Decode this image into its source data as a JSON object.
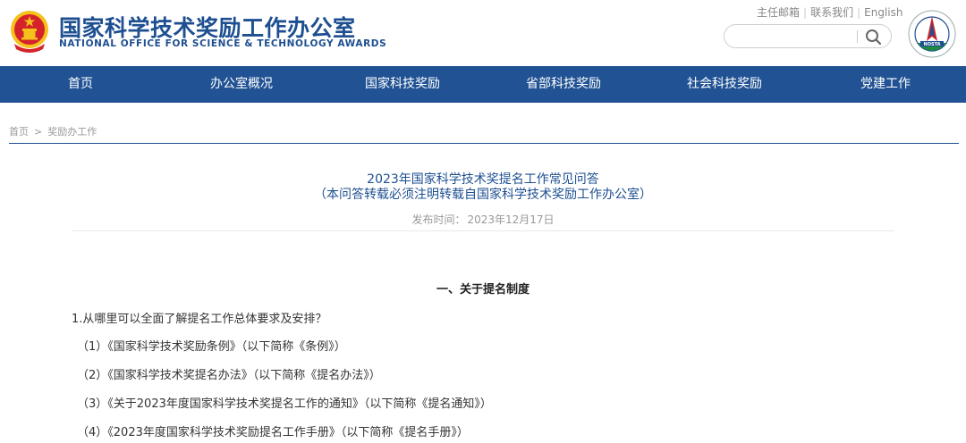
{
  "site": {
    "title_cn": "国家科学技术奖励工作办公室",
    "title_en": "NATIONAL OFFICE FOR SCIENCE & TECHNOLOGY AWARDS",
    "logo_text": "NOSTA"
  },
  "top_links": [
    "主任邮箱",
    "联系我们",
    "English"
  ],
  "search": {
    "placeholder": ""
  },
  "nav": [
    "首页",
    "办公室概况",
    "国家科技奖励",
    "省部科技奖励",
    "社会科技奖励",
    "党建工作"
  ],
  "breadcrumb": [
    "首页",
    ">",
    "奖励办工作"
  ],
  "article": {
    "title": "2023年国家科学技术奖提名工作常见问答",
    "subtitle": "（本问答转载必须注明转载自国家科学技术奖励工作办公室）",
    "date_label": "发布时间：",
    "date": "2023年12月17日"
  },
  "content": {
    "section_heading": "一、关于提名制度",
    "question": "1.从哪里可以全面了解提名工作总体要求及安排？",
    "answers": [
      "（1）《国家科学技术奖励条例》（以下简称《条例》）",
      "（2）《国家科学技术奖提名办法》（以下简称《提名办法》）",
      "（3）《关于2023年度国家科学技术奖提名工作的通知》（以下简称《提名通知》）",
      "（4）《2023年度国家科学技术奖励提名工作手册》（以下简称《提名手册》）"
    ]
  },
  "colors": {
    "brand_blue": "#1d4f91",
    "nav_bg": "#215394",
    "emblem_red": "#d5232b",
    "emblem_gold": "#f4c21b"
  }
}
